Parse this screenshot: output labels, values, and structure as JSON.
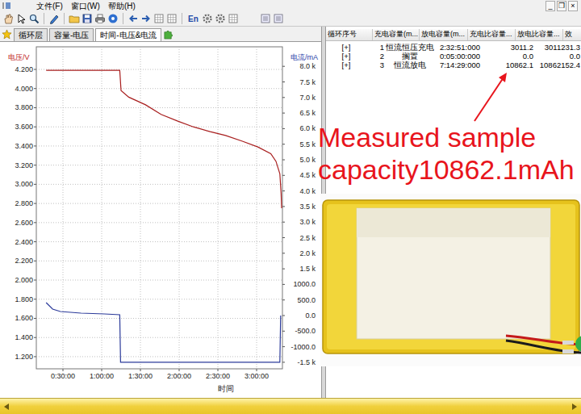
{
  "menu": {
    "items": [
      "文件(F)",
      "窗口(W)",
      "帮助(H)"
    ],
    "window_buttons": [
      "_",
      "❐",
      "×"
    ]
  },
  "toolbar": {
    "language_button": "En"
  },
  "tabs": [
    {
      "label": "循环层",
      "selected": false
    },
    {
      "label": "容量-电压",
      "selected": false
    },
    {
      "label": "时间-电压&电流",
      "selected": true
    }
  ],
  "chart": {
    "left_axis": {
      "title": "电压/V",
      "ticks": [
        "4.200",
        "4.000",
        "3.800",
        "3.600",
        "3.400",
        "3.200",
        "3.000",
        "2.800",
        "2.600",
        "2.400",
        "2.200",
        "2.000",
        "1.800",
        "1.600",
        "1.400",
        "1.200"
      ]
    },
    "right_axis": {
      "title": "电流/mA",
      "ticks": [
        "8.0 k",
        "7.5 k",
        "7.0 k",
        "6.5 k",
        "6.0 k",
        "5.5 k",
        "5.0 k",
        "4.5 k",
        "4.0 k",
        "3.5 k",
        "3.0 k",
        "2.5 k",
        "2.0 k",
        "1.5 k",
        "1000.0",
        "500.0",
        "0.0",
        "-500.0",
        "-1000.0",
        "-1.5 k"
      ]
    },
    "x_axis": {
      "title": "时间",
      "ticks": [
        "0:30:00",
        "1:00:00",
        "1:30:00",
        "2:00:00",
        "2:30:00",
        "3:00:00"
      ]
    },
    "series": [
      {
        "kind": "voltage",
        "color": "#a81e1e",
        "times": [
          17,
          74,
          75,
          81,
          94,
          106,
          119,
          131,
          144,
          156,
          169,
          181,
          191,
          195,
          198,
          199,
          199.4
        ],
        "values": [
          4.19,
          4.19,
          3.98,
          3.91,
          3.83,
          3.73,
          3.66,
          3.6,
          3.55,
          3.51,
          3.45,
          3.39,
          3.32,
          3.24,
          3.11,
          2.9,
          2.75
        ]
      },
      {
        "kind": "current",
        "color": "#2b3a9a",
        "times": [
          17,
          22,
          28,
          44,
          62,
          74,
          74.6,
          198,
          198.6
        ],
        "values": [
          415,
          207,
          130,
          78,
          52,
          26,
          -1500,
          -1500,
          0
        ]
      }
    ]
  },
  "table": {
    "columns": [
      "循环序号",
      "充电容量(m...",
      "放电容量(m...",
      "充电比容量...",
      "放电比容量...",
      "效"
    ],
    "rows": [
      [
        "[+]",
        "1",
        "恒流恒压充电",
        "2:32:51:000",
        "3011.2",
        "3011231.3"
      ],
      [
        "[+]",
        "2",
        "搁置",
        "0:05:00:000",
        "0.0",
        "0.0"
      ],
      [
        "[+]",
        "3",
        "恒流放电",
        "7:14:29:000",
        "10862.1",
        "10862152.4"
      ]
    ]
  },
  "annotation": {
    "lines": [
      "Measured sample",
      "capacity10862.1mAh"
    ]
  }
}
